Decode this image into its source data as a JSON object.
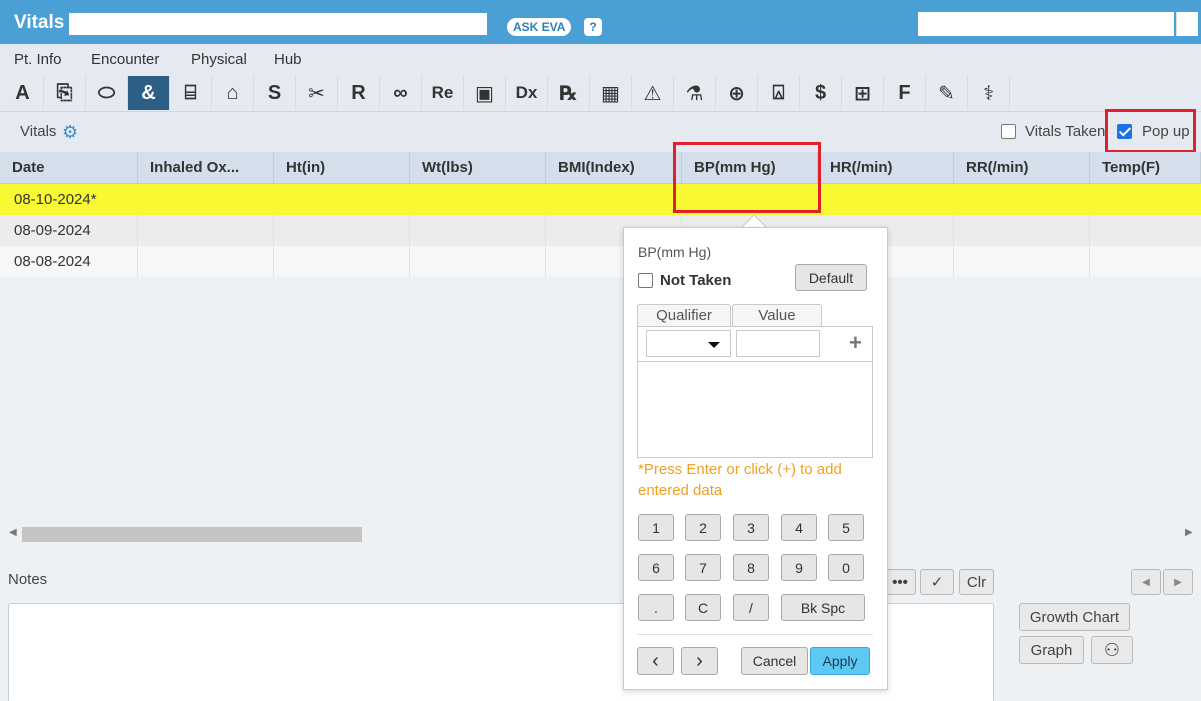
{
  "window": {
    "title": "Vitals",
    "ask_eva": "ASK EVA",
    "help": "?"
  },
  "menu": [
    "Pt. Info",
    "Encounter",
    "Physical",
    "Hub"
  ],
  "toolbar": {
    "tools": [
      {
        "label": "A",
        "icon": "allergy-icon"
      },
      {
        "label": "⎘",
        "icon": "documents-icon"
      },
      {
        "label": "⬭",
        "icon": "pill-icon"
      },
      {
        "label": "&",
        "icon": "stethoscope-icon"
      },
      {
        "label": "⌸",
        "icon": "monitor-icon"
      },
      {
        "label": "⌂",
        "icon": "family-icon"
      },
      {
        "label": "S",
        "icon": "social-history-icon"
      },
      {
        "label": "✂",
        "icon": "surgery-icon"
      },
      {
        "label": "R",
        "icon": "review-icon"
      },
      {
        "label": "∞",
        "icon": "eyeglasses-icon"
      },
      {
        "label": "Re",
        "icon": "results-icon"
      },
      {
        "label": "▣",
        "icon": "jar-icon"
      },
      {
        "label": "Dx",
        "icon": "diagnosis-icon"
      },
      {
        "label": "℞",
        "icon": "prescription-icon"
      },
      {
        "label": "▦",
        "icon": "grid-icon"
      },
      {
        "label": "⚠",
        "icon": "alert-clipboard-icon"
      },
      {
        "label": "⚗",
        "icon": "lab-icon"
      },
      {
        "label": "⊕",
        "icon": "procedures-icon"
      },
      {
        "label": "⍓",
        "icon": "bell-icon"
      },
      {
        "label": "$",
        "icon": "billing-icon"
      },
      {
        "label": "⊞",
        "icon": "forms-icon"
      },
      {
        "label": "F",
        "icon": "flowsheet-icon"
      },
      {
        "label": "✎",
        "icon": "edit-icon"
      },
      {
        "label": "⚕",
        "icon": "equipment-icon"
      }
    ]
  },
  "section": {
    "title": "Vitals",
    "vitals_taken": "Vitals Taken",
    "popup": "Pop up"
  },
  "table": {
    "headers": [
      "Date",
      "Inhaled Ox...",
      "Ht(in)",
      "Wt(lbs)",
      "BMI(Index)",
      "BP(mm Hg)",
      "HR(/min)",
      "RR(/min)",
      "Temp(F)"
    ],
    "rows": [
      {
        "date": "08-10-2024*"
      },
      {
        "date": "08-09-2024"
      },
      {
        "date": "08-08-2024"
      }
    ]
  },
  "notes": {
    "label": "Notes",
    "clr": "Clr",
    "more": "•••",
    "growth_chart": "Growth Chart",
    "graph": "Graph"
  },
  "popup": {
    "title": "BP(mm Hg)",
    "not_taken": "Not Taken",
    "default": "Default",
    "qualifier_tab": "Qualifier",
    "value_tab": "Value",
    "hint": "*Press Enter or click (+) to add entered data",
    "keys_row1": [
      "1",
      "2",
      "3",
      "4",
      "5"
    ],
    "keys_row2": [
      "6",
      "7",
      "8",
      "9",
      "0"
    ],
    "keys_row3": [
      ".",
      "C",
      "/"
    ],
    "bkspc": "Bk Spc",
    "prev": "‹",
    "next": "›",
    "cancel": "Cancel",
    "apply": "Apply"
  },
  "colors": {
    "titlebar": "#4a9fd5",
    "highlight_row": "#f9f933",
    "red_box": "#e0202b",
    "hint": "#f0a020",
    "apply": "#5ec8f4"
  }
}
